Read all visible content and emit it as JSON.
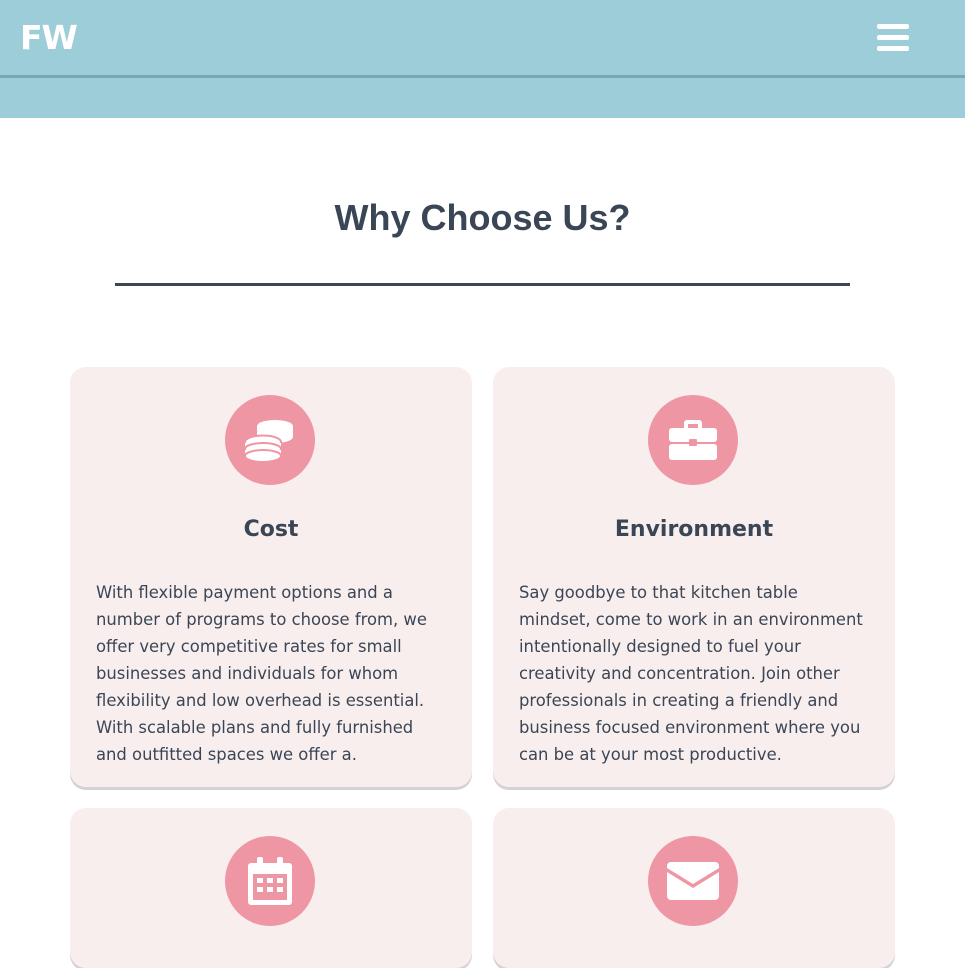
{
  "header": {
    "logo_text": "FW",
    "menu_icon": "hamburger-icon",
    "bar_color": "#9dcdd8"
  },
  "section": {
    "title": "Why Choose Us?"
  },
  "cards": [
    {
      "icon": "coins-icon",
      "title": "Cost",
      "body": "With flexible payment options and a number of programs to choose from, we offer very competitive rates for small businesses and individuals for whom flexibility and low overhead is essential. With scalable plans and fully furnished and outfitted spaces we offer a."
    },
    {
      "icon": "briefcase-icon",
      "title": "Environment",
      "body": "Say goodbye to that kitchen table mindset, come to work in an environment intentionally designed to fuel your creativity and concentration. Join other professionals in creating a friendly and business focused environment where you can be at your most productive."
    },
    {
      "icon": "calendar-icon",
      "title": "",
      "body": ""
    },
    {
      "icon": "envelope-icon",
      "title": "",
      "body": ""
    }
  ],
  "colors": {
    "accent": "#ef96a4",
    "card_bg": "#f9eeee",
    "text": "#3a4656"
  }
}
